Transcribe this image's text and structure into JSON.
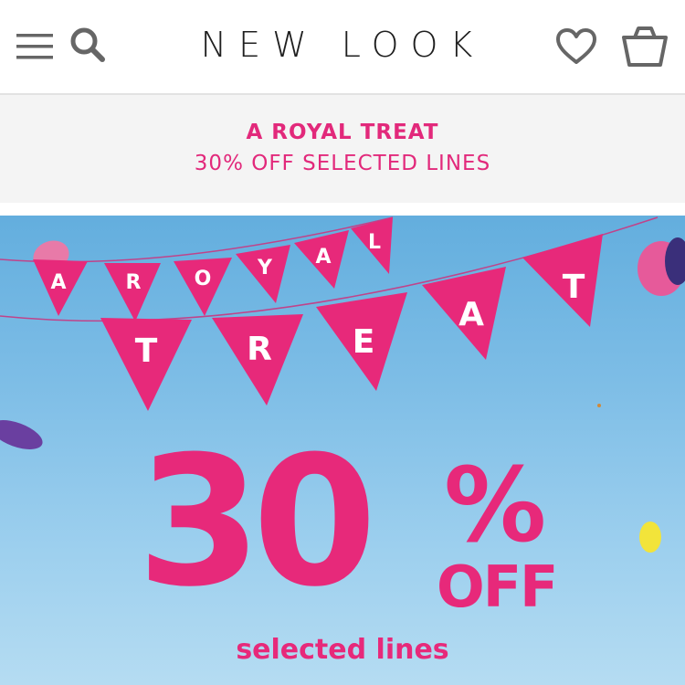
{
  "header": {
    "brand": "NEW LOOK",
    "icons": [
      "menu-icon",
      "search-icon",
      "heart-icon",
      "bag-icon"
    ]
  },
  "promo": {
    "title": "A ROYAL TREAT",
    "subtitle": "30% OFF SELECTED LINES"
  },
  "hero": {
    "bunting_row1": [
      "A",
      "R",
      "O",
      "Y",
      "A",
      "L"
    ],
    "bunting_row2": [
      "T",
      "R",
      "E",
      "A",
      "T"
    ],
    "discount_number": "30",
    "discount_symbol": "%",
    "discount_off": "OFF",
    "caption": "selected lines"
  },
  "colors": {
    "brand_pink": "#e7297a",
    "promo_pink": "#e2297b",
    "sky_blue": "#7dbde6",
    "icon_grey": "#666666"
  }
}
